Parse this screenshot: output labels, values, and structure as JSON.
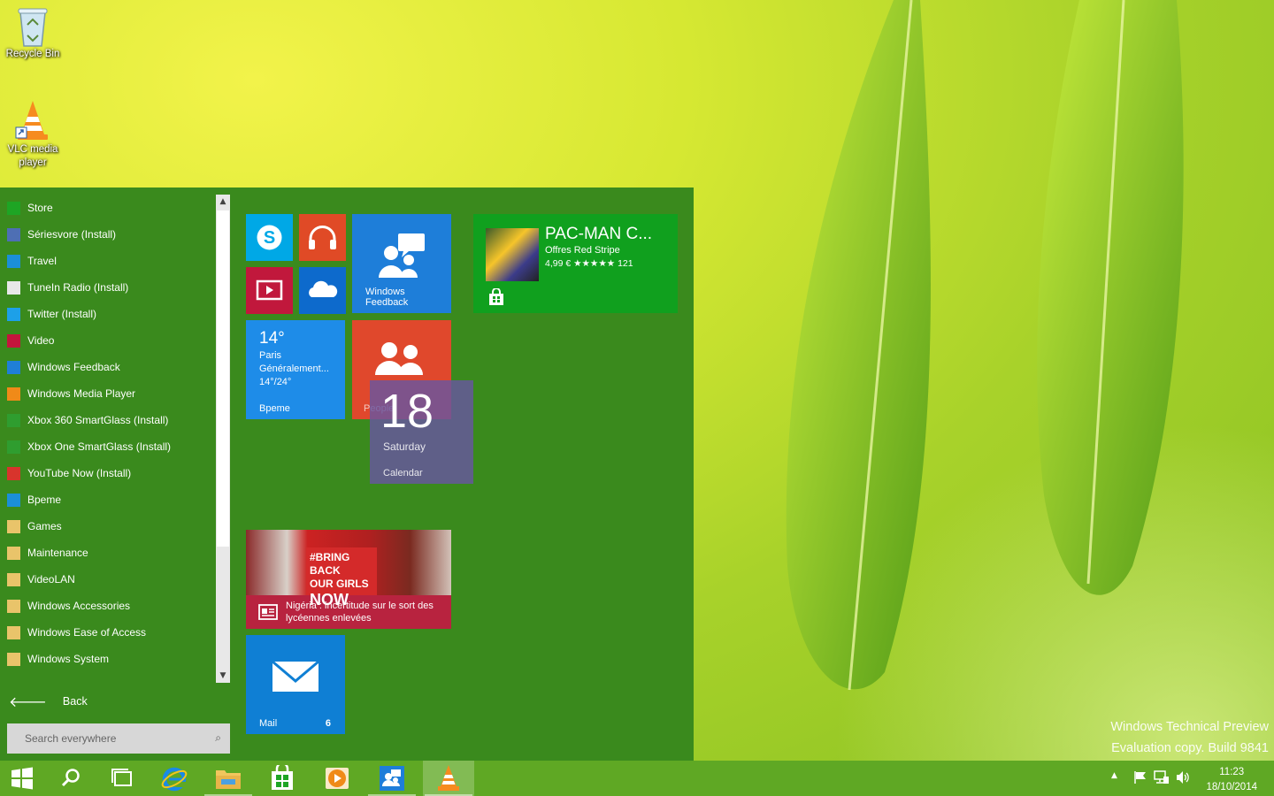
{
  "desktop": {
    "recycle_bin_label": "Recycle Bin",
    "vlc_label": "VLC media player"
  },
  "watermark": {
    "line1": "Windows Technical Preview",
    "line2": "Evaluation copy. Build 9841"
  },
  "start_menu": {
    "apps": [
      {
        "label": "Store",
        "icon": "store-icon",
        "color": "#1ea524"
      },
      {
        "label": "Sériesvore (Install)",
        "icon": "seriesvore-icon",
        "color": "#4e6fb4"
      },
      {
        "label": "Travel",
        "icon": "travel-icon",
        "color": "#1b8fd8"
      },
      {
        "label": "TuneIn Radio (Install)",
        "icon": "tunein-icon",
        "color": "#e8e8e8"
      },
      {
        "label": "Twitter (Install)",
        "icon": "twitter-icon",
        "color": "#1da0e8"
      },
      {
        "label": "Video",
        "icon": "video-icon",
        "color": "#c4153c"
      },
      {
        "label": "Windows Feedback",
        "icon": "feedback-icon",
        "color": "#1f7fd8"
      },
      {
        "label": "Windows Media Player",
        "icon": "media-player-icon",
        "color": "#f08a18"
      },
      {
        "label": "Xbox 360 SmartGlass (Install)",
        "icon": "xbox-icon",
        "color": "#2f9d2f"
      },
      {
        "label": "Xbox One SmartGlass (Install)",
        "icon": "xbox-icon",
        "color": "#2f9d2f"
      },
      {
        "label": "YouTube Now (Install)",
        "icon": "youtube-icon",
        "color": "#d8342c"
      },
      {
        "label": "Bpeme",
        "icon": "weather-icon",
        "color": "#1b8fd8"
      },
      {
        "label": "Games",
        "icon": "folder-icon",
        "color": "#e9c46a"
      },
      {
        "label": "Maintenance",
        "icon": "folder-icon",
        "color": "#e9c46a"
      },
      {
        "label": "VideoLAN",
        "icon": "folder-icon",
        "color": "#e9c46a"
      },
      {
        "label": "Windows Accessories",
        "icon": "folder-icon",
        "color": "#e9c46a"
      },
      {
        "label": "Windows Ease of Access",
        "icon": "folder-icon",
        "color": "#e9c46a"
      },
      {
        "label": "Windows System",
        "icon": "folder-icon",
        "color": "#e9c46a"
      }
    ],
    "back_label": "Back",
    "search_placeholder": "Search everywhere",
    "tiles": {
      "feedback_label": "Windows Feedback",
      "pacman_title": "PAC-MAN C...",
      "pacman_publisher": "Offres Red Stripe",
      "pacman_price": "4,99 € ★★★★★ 121",
      "weather_temp": "14°",
      "weather_city": "Paris",
      "weather_desc": "Généralement...",
      "weather_range": "14°/24°",
      "weather_label": "Bpeme",
      "people_label": "People",
      "calendar_day": "18",
      "calendar_weekday": "Saturday",
      "calendar_label": "Calendar",
      "news_headline": "Nigéria : incertitude sur le sort des lycéennes enlevées",
      "news_sign_1": "#BRING BACK",
      "news_sign_2": "OUR GIRLS",
      "news_sign_3": "NOW",
      "mail_label": "Mail",
      "mail_count": "6"
    }
  },
  "taskbar": {
    "time": "11:23",
    "date": "18/10/2014"
  },
  "colors": {
    "start_bg": "#3a8a1d",
    "taskbar_bg": "#5fa824"
  }
}
